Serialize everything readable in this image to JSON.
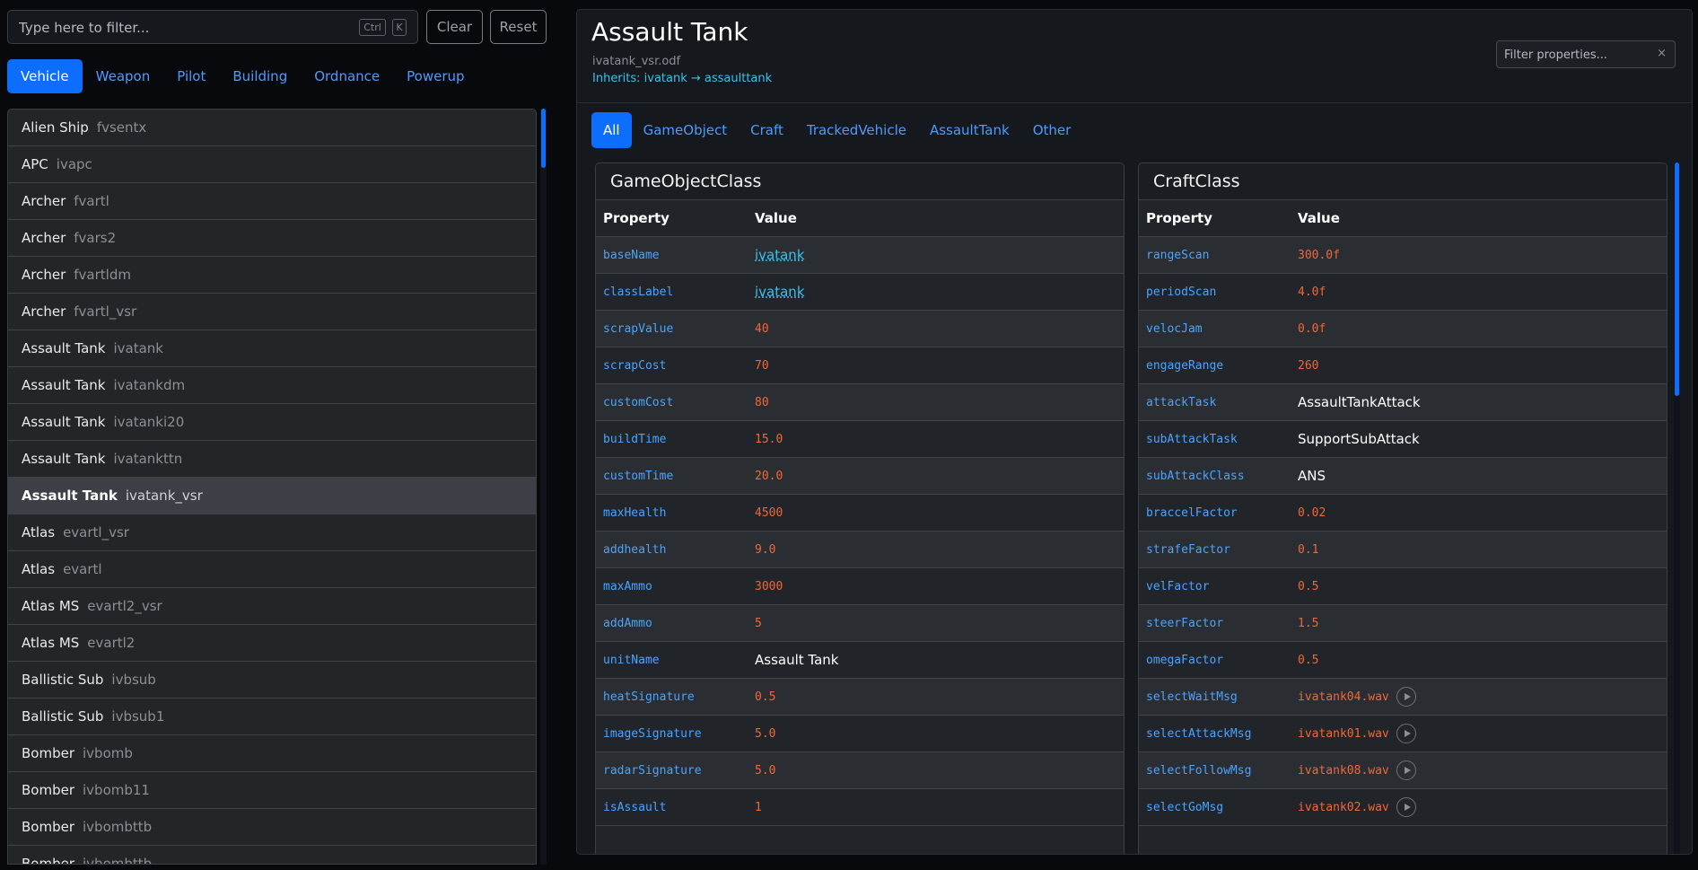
{
  "search": {
    "placeholder": "Type here to filter...",
    "kbd_ctrl": "Ctrl",
    "kbd_k": "K",
    "clear_label": "Clear",
    "reset_label": "Reset"
  },
  "categories": [
    "Vehicle",
    "Weapon",
    "Pilot",
    "Building",
    "Ordnance",
    "Powerup"
  ],
  "active_category": "Vehicle",
  "items": [
    {
      "name": "Alien Ship",
      "code": "fvsentx"
    },
    {
      "name": "APC",
      "code": "ivapc"
    },
    {
      "name": "Archer",
      "code": "fvartl"
    },
    {
      "name": "Archer",
      "code": "fvars2"
    },
    {
      "name": "Archer",
      "code": "fvartldm"
    },
    {
      "name": "Archer",
      "code": "fvartl_vsr"
    },
    {
      "name": "Assault Tank",
      "code": "ivatank"
    },
    {
      "name": "Assault Tank",
      "code": "ivatankdm"
    },
    {
      "name": "Assault Tank",
      "code": "ivatanki20"
    },
    {
      "name": "Assault Tank",
      "code": "ivatankttn"
    },
    {
      "name": "Assault Tank",
      "code": "ivatank_vsr"
    },
    {
      "name": "Atlas",
      "code": "evartl_vsr"
    },
    {
      "name": "Atlas",
      "code": "evartl"
    },
    {
      "name": "Atlas MS",
      "code": "evartl2_vsr"
    },
    {
      "name": "Atlas MS",
      "code": "evartl2"
    },
    {
      "name": "Ballistic Sub",
      "code": "ivbsub"
    },
    {
      "name": "Ballistic Sub",
      "code": "ivbsub1"
    },
    {
      "name": "Bomber",
      "code": "ivbomb"
    },
    {
      "name": "Bomber",
      "code": "ivbomb11"
    },
    {
      "name": "Bomber",
      "code": "ivbombttb"
    },
    {
      "name": "Bomber",
      "code": "ivbombttb"
    }
  ],
  "selected_index": 10,
  "detail": {
    "title": "Assault Tank",
    "file": "ivatank_vsr.odf",
    "inherits": "Inherits: ivatank → assaulttank",
    "filter_placeholder": "Filter properties...",
    "clear_icon": "×",
    "class_tabs": [
      "All",
      "GameObject",
      "Craft",
      "TrackedVehicle",
      "AssaultTank",
      "Other"
    ],
    "active_class_tab": "All",
    "prop_header": "Property",
    "value_header": "Value"
  },
  "game_object": {
    "title": "GameObjectClass",
    "rows": [
      {
        "prop": "baseName",
        "value": "ivatank",
        "kind": "link"
      },
      {
        "prop": "classLabel",
        "value": "ivatank",
        "kind": "link"
      },
      {
        "prop": "scrapValue",
        "value": "40",
        "kind": "num"
      },
      {
        "prop": "scrapCost",
        "value": "70",
        "kind": "num"
      },
      {
        "prop": "customCost",
        "value": "80",
        "kind": "num"
      },
      {
        "prop": "buildTime",
        "value": "15.0",
        "kind": "num"
      },
      {
        "prop": "customTime",
        "value": "20.0",
        "kind": "num"
      },
      {
        "prop": "maxHealth",
        "value": "4500",
        "kind": "num"
      },
      {
        "prop": "addhealth",
        "value": "9.0",
        "kind": "num"
      },
      {
        "prop": "maxAmmo",
        "value": "3000",
        "kind": "num"
      },
      {
        "prop": "addAmmo",
        "value": "5",
        "kind": "num"
      },
      {
        "prop": "unitName",
        "value": "Assault Tank",
        "kind": "str"
      },
      {
        "prop": "heatSignature",
        "value": "0.5",
        "kind": "num"
      },
      {
        "prop": "imageSignature",
        "value": "5.0",
        "kind": "num"
      },
      {
        "prop": "radarSignature",
        "value": "5.0",
        "kind": "num"
      },
      {
        "prop": "isAssault",
        "value": "1",
        "kind": "num"
      }
    ]
  },
  "craft": {
    "title": "CraftClass",
    "rows": [
      {
        "prop": "rangeScan",
        "value": "300.0f",
        "kind": "num"
      },
      {
        "prop": "periodScan",
        "value": "4.0f",
        "kind": "num"
      },
      {
        "prop": "velocJam",
        "value": "0.0f",
        "kind": "num"
      },
      {
        "prop": "engageRange",
        "value": "260",
        "kind": "num"
      },
      {
        "prop": "attackTask",
        "value": "AssaultTankAttack",
        "kind": "str"
      },
      {
        "prop": "subAttackTask",
        "value": "SupportSubAttack",
        "kind": "str"
      },
      {
        "prop": "subAttackClass",
        "value": "ANS",
        "kind": "str"
      },
      {
        "prop": "braccelFactor",
        "value": "0.02",
        "kind": "num"
      },
      {
        "prop": "strafeFactor",
        "value": "0.1",
        "kind": "num"
      },
      {
        "prop": "velFactor",
        "value": "0.5",
        "kind": "num"
      },
      {
        "prop": "steerFactor",
        "value": "1.5",
        "kind": "num"
      },
      {
        "prop": "omegaFactor",
        "value": "0.5",
        "kind": "num"
      },
      {
        "prop": "selectWaitMsg",
        "value": "ivatank04.wav",
        "kind": "audio"
      },
      {
        "prop": "selectAttackMsg",
        "value": "ivatank01.wav",
        "kind": "audio"
      },
      {
        "prop": "selectFollowMsg",
        "value": "ivatank08.wav",
        "kind": "audio"
      },
      {
        "prop": "selectGoMsg",
        "value": "ivatank02.wav",
        "kind": "audio"
      }
    ]
  }
}
